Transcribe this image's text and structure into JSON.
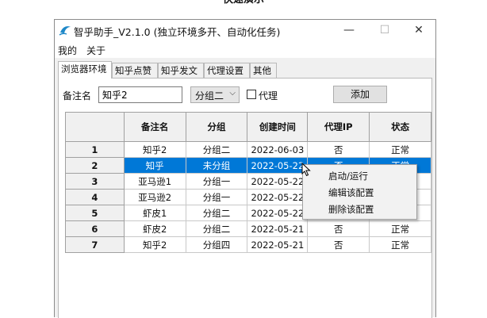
{
  "banner": "快速演示",
  "window": {
    "title": "智乎助手_V2.1.0 (独立环境多开、自动化任务)",
    "minimize": "—",
    "maximize": "☐",
    "close": "✕"
  },
  "menu": [
    "我的",
    "关于"
  ],
  "tabs": [
    "浏览器环境",
    "知乎点赞",
    "知乎发文",
    "代理设置",
    "其他"
  ],
  "form": {
    "note_label": "备注名",
    "note_value": "知乎2",
    "group_value": "分组二",
    "proxy_label": "代理",
    "add_button": "添加"
  },
  "table": {
    "columns": [
      "备注名",
      "分组",
      "创建时间",
      "代理IP",
      "状态"
    ],
    "rows": [
      {
        "num": "1",
        "name": "知乎2",
        "group": "分组二",
        "date": "2022-06-03",
        "proxy": "否",
        "status": "正常"
      },
      {
        "num": "2",
        "name": "知乎",
        "group": "未分组",
        "date": "2022-05-22",
        "proxy": "否",
        "status": "正常"
      },
      {
        "num": "3",
        "name": "亚马逊1",
        "group": "分组一",
        "date": "2022-05-22",
        "proxy": "",
        "status": ""
      },
      {
        "num": "4",
        "name": "亚马逊2",
        "group": "分组一",
        "date": "2022-05-22",
        "proxy": "",
        "status": ""
      },
      {
        "num": "5",
        "name": "虾皮1",
        "group": "分组二",
        "date": "2022-05-22",
        "proxy": "",
        "status": ""
      },
      {
        "num": "6",
        "name": "虾皮2",
        "group": "分组二",
        "date": "2022-05-21",
        "proxy": "否",
        "status": "正常"
      },
      {
        "num": "7",
        "name": "知乎2",
        "group": "分组四",
        "date": "2022-05-21",
        "proxy": "否",
        "status": "正常"
      }
    ]
  },
  "context_menu": [
    "启动/运行",
    "编辑该配置",
    "删除该配置"
  ],
  "colors": {
    "selection": "#0078d7",
    "accent": "#1e88c8"
  }
}
